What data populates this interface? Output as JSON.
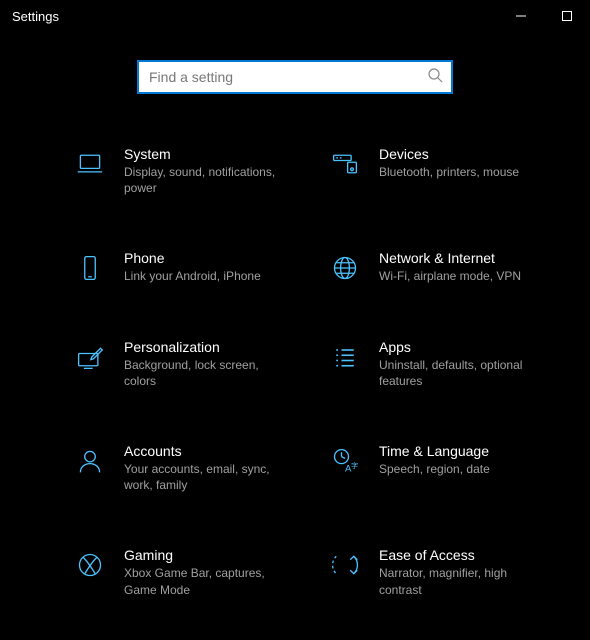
{
  "window": {
    "title": "Settings"
  },
  "search": {
    "placeholder": "Find a setting",
    "value": ""
  },
  "categories": [
    {
      "id": "system",
      "title": "System",
      "desc": "Display, sound, notifications, power",
      "icon": "laptop"
    },
    {
      "id": "devices",
      "title": "Devices",
      "desc": "Bluetooth, printers, mouse",
      "icon": "devices"
    },
    {
      "id": "phone",
      "title": "Phone",
      "desc": "Link your Android, iPhone",
      "icon": "phone"
    },
    {
      "id": "network",
      "title": "Network & Internet",
      "desc": "Wi-Fi, airplane mode, VPN",
      "icon": "globe"
    },
    {
      "id": "personalization",
      "title": "Personalization",
      "desc": "Background, lock screen, colors",
      "icon": "pen-monitor"
    },
    {
      "id": "apps",
      "title": "Apps",
      "desc": "Uninstall, defaults, optional features",
      "icon": "list"
    },
    {
      "id": "accounts",
      "title": "Accounts",
      "desc": "Your accounts, email, sync, work, family",
      "icon": "person"
    },
    {
      "id": "time",
      "title": "Time & Language",
      "desc": "Speech, region, date",
      "icon": "time-lang"
    },
    {
      "id": "gaming",
      "title": "Gaming",
      "desc": "Xbox Game Bar, captures, Game Mode",
      "icon": "xbox"
    },
    {
      "id": "ease",
      "title": "Ease of Access",
      "desc": "Narrator, magnifier, high contrast",
      "icon": "ease"
    }
  ],
  "colors": {
    "accent": "#4cc2ff",
    "searchBorder": "#0078d4"
  }
}
